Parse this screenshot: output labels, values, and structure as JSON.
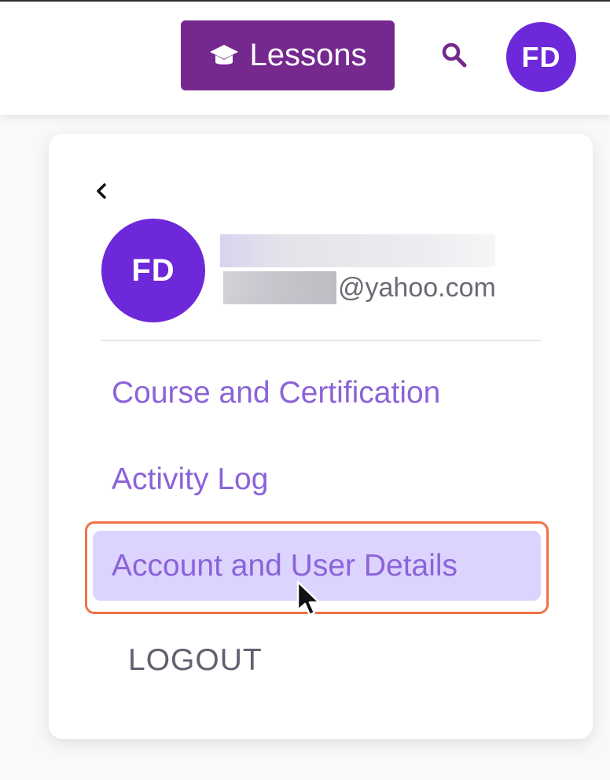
{
  "header": {
    "lessons_label": "Lessons",
    "lessons_icon": "graduation-cap-icon",
    "search_icon": "search-icon",
    "avatar_initials": "FD"
  },
  "dropdown": {
    "back_icon": "chevron-left-icon",
    "user": {
      "initials": "FD",
      "email_domain": "@yahoo.com"
    },
    "menu": {
      "course": "Course and Certification",
      "activity": "Activity Log",
      "account": "Account and User Details",
      "logout": "LOGOUT"
    }
  },
  "colors": {
    "brand_purple": "#75298f",
    "avatar_purple": "#6d28d9",
    "menu_text": "#8b63d9",
    "highlight_bg": "#dcd4ff",
    "highlight_outline": "#ef7346"
  }
}
